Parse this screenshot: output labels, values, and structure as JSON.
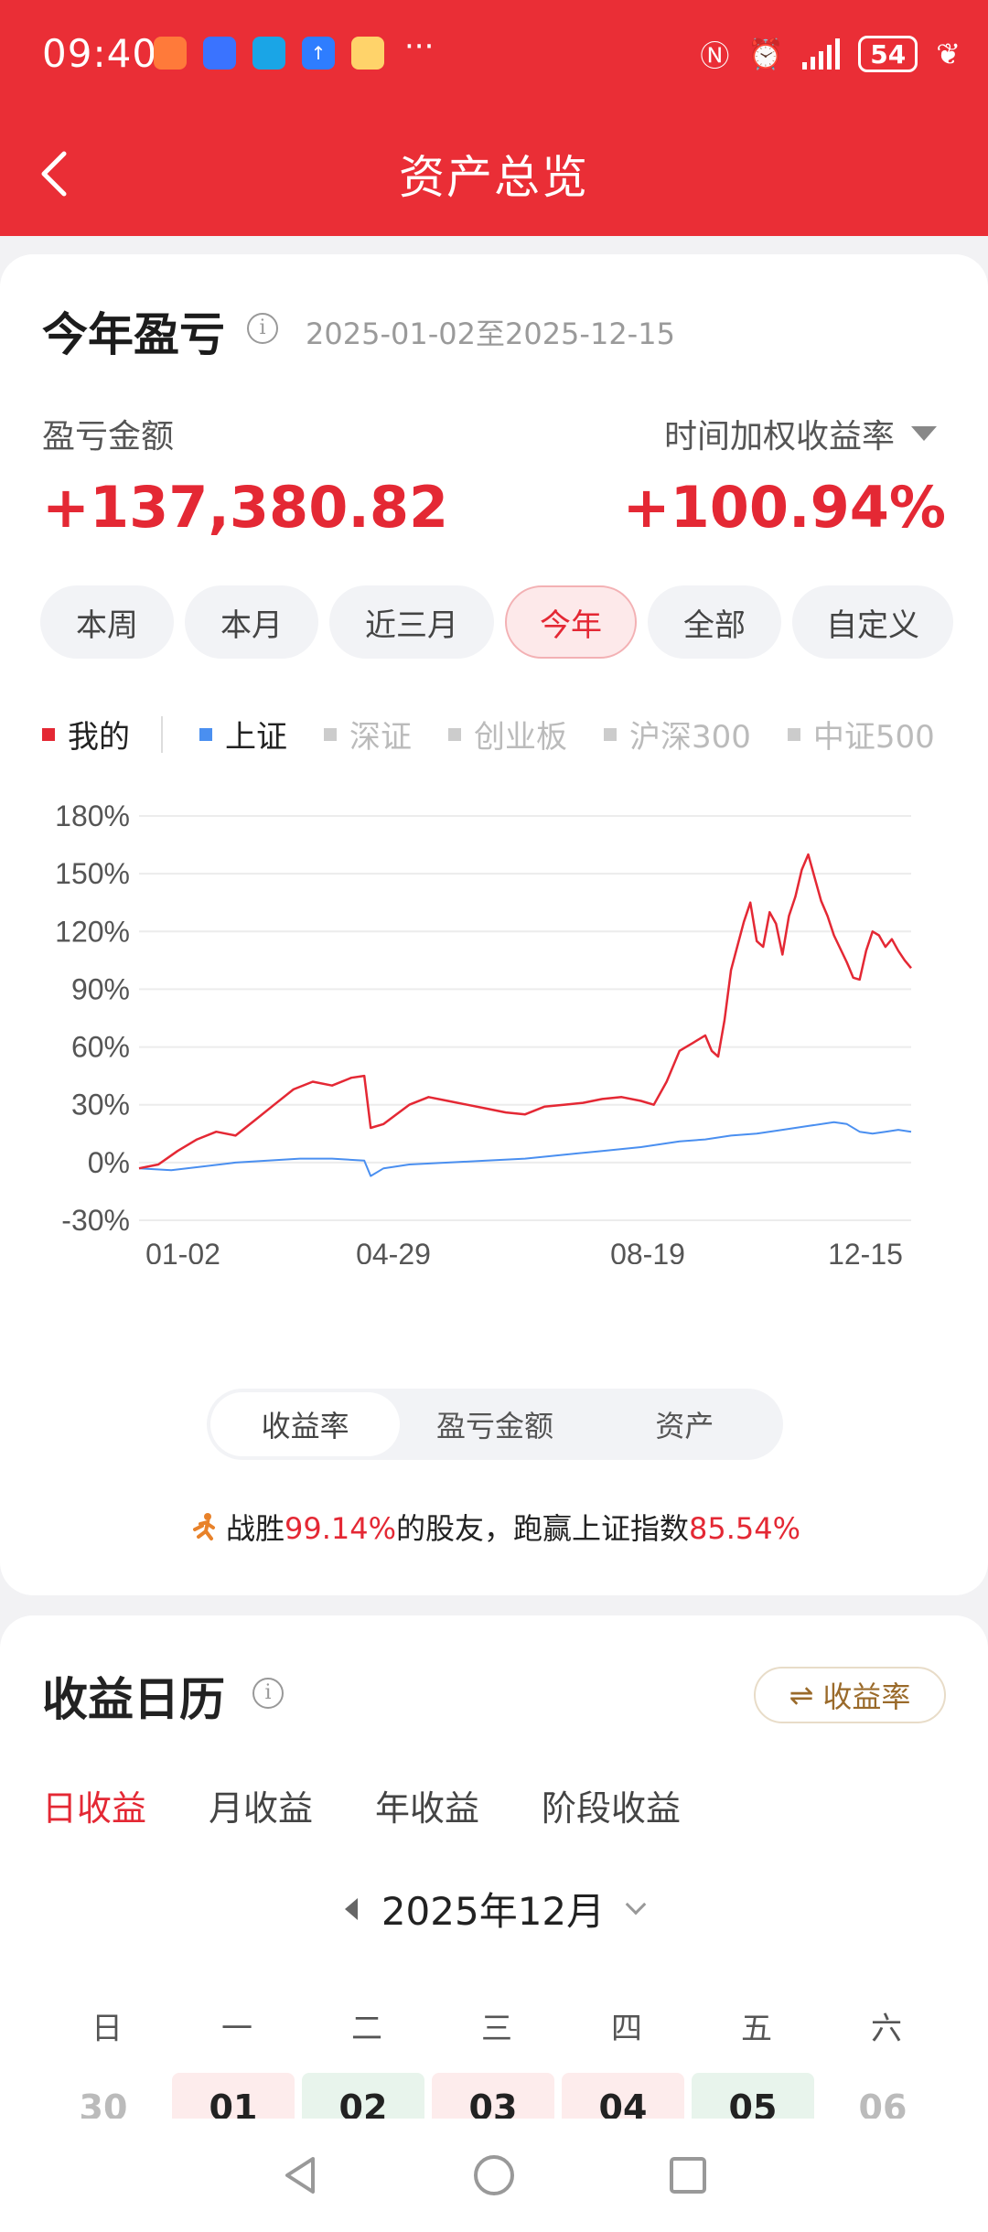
{
  "status_bar": {
    "time": "09:40",
    "apps": [
      {
        "icon": "red-app-icon",
        "color": "#ff7a3a"
      },
      {
        "icon": "blue-app-icon",
        "color": "#3a73ff"
      },
      {
        "icon": "teal-app-icon",
        "color": "#1aa5e6"
      },
      {
        "icon": "upload-app-icon",
        "color": "#2e7dff"
      },
      {
        "icon": "weather-app-icon",
        "color": "#ffd36a"
      }
    ],
    "more": "···",
    "battery": "54"
  },
  "header": {
    "title": "资产总览",
    "back_icon": "back-arrow-icon"
  },
  "summary": {
    "title": "今年盈亏",
    "info_icon": "info-icon",
    "date_range": "2025-01-02至2025-12-15",
    "pl_label": "盈亏金额",
    "pl_value": "+137,380.82",
    "twr_label": "时间加权收益率",
    "twr_value": "+100.94%"
  },
  "periods": [
    {
      "label": "本周",
      "active": false
    },
    {
      "label": "本月",
      "active": false
    },
    {
      "label": "近三月",
      "active": false
    },
    {
      "label": "今年",
      "active": true
    },
    {
      "label": "全部",
      "active": false
    },
    {
      "label": "自定义",
      "active": false
    }
  ],
  "legend": [
    {
      "label": "我的",
      "color": "#e42834",
      "active": true
    },
    {
      "label": "上证",
      "color": "#4a8ff0",
      "active": true
    },
    {
      "label": "深证",
      "color": "#cccccc",
      "active": false
    },
    {
      "label": "创业板",
      "color": "#cccccc",
      "active": false
    },
    {
      "label": "沪深300",
      "color": "#cccccc",
      "active": false
    },
    {
      "label": "中证500",
      "color": "#cccccc",
      "active": false
    }
  ],
  "chart_data": {
    "type": "line",
    "x_ticks": [
      "01-02",
      "04-29",
      "08-19",
      "12-15"
    ],
    "y_ticks": [
      "180%",
      "150%",
      "120%",
      "90%",
      "60%",
      "30%",
      "0%",
      "-30%"
    ],
    "ylim": [
      -30,
      180
    ],
    "grid": true,
    "series": [
      {
        "name": "我的",
        "color": "#e42834",
        "points": [
          [
            0,
            -3
          ],
          [
            3,
            -1
          ],
          [
            6,
            6
          ],
          [
            9,
            12
          ],
          [
            12,
            16
          ],
          [
            15,
            14
          ],
          [
            18,
            22
          ],
          [
            21,
            30
          ],
          [
            24,
            38
          ],
          [
            27,
            42
          ],
          [
            30,
            40
          ],
          [
            33,
            44
          ],
          [
            35,
            45
          ],
          [
            36,
            18
          ],
          [
            38,
            20
          ],
          [
            40,
            25
          ],
          [
            42,
            30
          ],
          [
            45,
            34
          ],
          [
            48,
            32
          ],
          [
            51,
            30
          ],
          [
            54,
            28
          ],
          [
            57,
            26
          ],
          [
            60,
            25
          ],
          [
            63,
            29
          ],
          [
            66,
            30
          ],
          [
            69,
            31
          ],
          [
            72,
            33
          ],
          [
            75,
            34
          ],
          [
            78,
            32
          ],
          [
            80,
            30
          ],
          [
            82,
            42
          ],
          [
            84,
            58
          ],
          [
            86,
            62
          ],
          [
            88,
            66
          ],
          [
            89,
            58
          ],
          [
            90,
            55
          ],
          [
            91,
            74
          ],
          [
            92,
            100
          ],
          [
            94,
            125
          ],
          [
            95,
            135
          ],
          [
            96,
            115
          ],
          [
            97,
            112
          ],
          [
            98,
            130
          ],
          [
            99,
            124
          ],
          [
            100,
            108
          ],
          [
            101,
            128
          ],
          [
            102,
            138
          ],
          [
            103,
            152
          ],
          [
            104,
            160
          ],
          [
            105,
            148
          ],
          [
            106,
            136
          ],
          [
            107,
            128
          ],
          [
            108,
            118
          ],
          [
            110,
            104
          ],
          [
            111,
            96
          ],
          [
            112,
            95
          ],
          [
            113,
            110
          ],
          [
            114,
            120
          ],
          [
            115,
            118
          ],
          [
            116,
            112
          ],
          [
            117,
            116
          ],
          [
            118,
            110
          ],
          [
            119,
            105
          ],
          [
            120,
            101
          ]
        ]
      },
      {
        "name": "上证",
        "color": "#4a8ff0",
        "points": [
          [
            0,
            -3
          ],
          [
            5,
            -4
          ],
          [
            10,
            -2
          ],
          [
            15,
            0
          ],
          [
            20,
            1
          ],
          [
            25,
            2
          ],
          [
            30,
            2
          ],
          [
            35,
            1
          ],
          [
            36,
            -7
          ],
          [
            38,
            -3
          ],
          [
            42,
            -1
          ],
          [
            48,
            0
          ],
          [
            54,
            1
          ],
          [
            60,
            2
          ],
          [
            66,
            4
          ],
          [
            72,
            6
          ],
          [
            78,
            8
          ],
          [
            84,
            11
          ],
          [
            88,
            12
          ],
          [
            92,
            14
          ],
          [
            96,
            15
          ],
          [
            100,
            17
          ],
          [
            104,
            19
          ],
          [
            108,
            21
          ],
          [
            110,
            20
          ],
          [
            112,
            16
          ],
          [
            114,
            15
          ],
          [
            116,
            16
          ],
          [
            118,
            17
          ],
          [
            120,
            16
          ]
        ]
      }
    ],
    "x_max": 120
  },
  "metric_tabs": [
    {
      "label": "收益率",
      "active": true
    },
    {
      "label": "盈亏金额",
      "active": false
    },
    {
      "label": "资产",
      "active": false
    }
  ],
  "beat": {
    "icon": "runner-icon",
    "p1": "战胜",
    "v1": "99.14%",
    "p2": "的股友，跑赢上证指数",
    "v2": "85.54%"
  },
  "calendar": {
    "title": "收益日历",
    "switch_label": "收益率",
    "tabs": [
      {
        "label": "日收益",
        "active": true
      },
      {
        "label": "月收益",
        "active": false
      },
      {
        "label": "年收益",
        "active": false
      },
      {
        "label": "阶段收益",
        "active": false
      }
    ],
    "month": "2025年12月",
    "weekdays": [
      "日",
      "一",
      "二",
      "三",
      "四",
      "五",
      "六"
    ],
    "days": [
      {
        "label": "30",
        "kind": "other"
      },
      {
        "label": "01",
        "kind": "gain"
      },
      {
        "label": "02",
        "kind": "loss"
      },
      {
        "label": "03",
        "kind": "gain"
      },
      {
        "label": "04",
        "kind": "gain"
      },
      {
        "label": "05",
        "kind": "loss"
      },
      {
        "label": "06",
        "kind": "other"
      }
    ]
  },
  "nav": [
    "back-nav-icon",
    "home-nav-icon",
    "recents-nav-icon"
  ]
}
